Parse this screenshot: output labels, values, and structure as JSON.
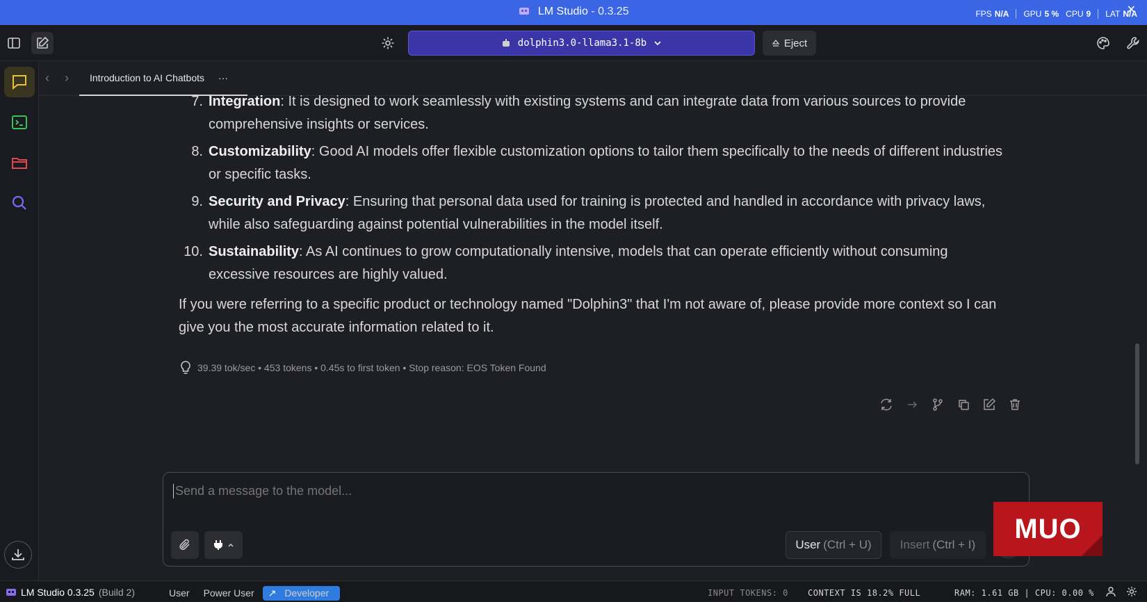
{
  "app": {
    "name": "LM Studio",
    "title_sep": " - ",
    "version": "0.3.25",
    "accent": "#3a66e6"
  },
  "stats": {
    "fps_label": "FPS",
    "fps_value": "N/A",
    "gpu_label": "GPU",
    "gpu_value": "5 %",
    "cpu_label": "CPU",
    "cpu_value": "9",
    "lat_label": "LAT",
    "lat_value": "N/A"
  },
  "toolbar": {
    "model_name": "dolphin3.0-llama3.1-8b",
    "eject_label": "Eject"
  },
  "tab": {
    "title": "Introduction to AI Chatbots",
    "more": "···"
  },
  "chat": {
    "items": [
      {
        "num": "7.",
        "term": "Integration",
        "text": ": It is designed to work seamlessly with existing systems and can integrate data from various sources to provide comprehensive insights or services."
      },
      {
        "num": "8.",
        "term": "Customizability",
        "text": ": Good AI models offer flexible customization options to tailor them specifically to the needs of different industries or specific tasks."
      },
      {
        "num": "9.",
        "term": "Security and Privacy",
        "text": ": Ensuring that personal data used for training is protected and handled in accordance with privacy laws, while also safeguarding against potential vulnerabilities in the model itself."
      },
      {
        "num": "10.",
        "term": "Sustainability",
        "text": ": As AI continues to grow computationally intensive, models that can operate efficiently without consuming excessive resources are highly valued."
      }
    ],
    "closing": "If you were referring to a specific product or technology named \"Dolphin3\" that I'm not aware of, please provide more context so I can give you the most accurate information related to it.",
    "meta": "39.39 tok/sec • 453 tokens • 0.45s to first token • Stop reason: EOS Token Found"
  },
  "composer": {
    "placeholder": "Send a message to the model...",
    "role_label": "User",
    "role_shortcut": "(Ctrl + U)",
    "insert_label": "Insert",
    "insert_shortcut": "(Ctrl + I)"
  },
  "watermark": "MUO",
  "status": {
    "brand": "LM Studio 0.3.25",
    "build": "(Build 2)",
    "modes": [
      "User",
      "Power User",
      "Developer"
    ],
    "active_mode": "Developer",
    "input_tokens_label": "INPUT TOKENS:",
    "input_tokens_value": "0",
    "context": "CONTEXT IS 18.2% FULL",
    "ram": "RAM: 1.61 GB",
    "sep": "|",
    "cpu": "CPU: 0.00 %"
  }
}
